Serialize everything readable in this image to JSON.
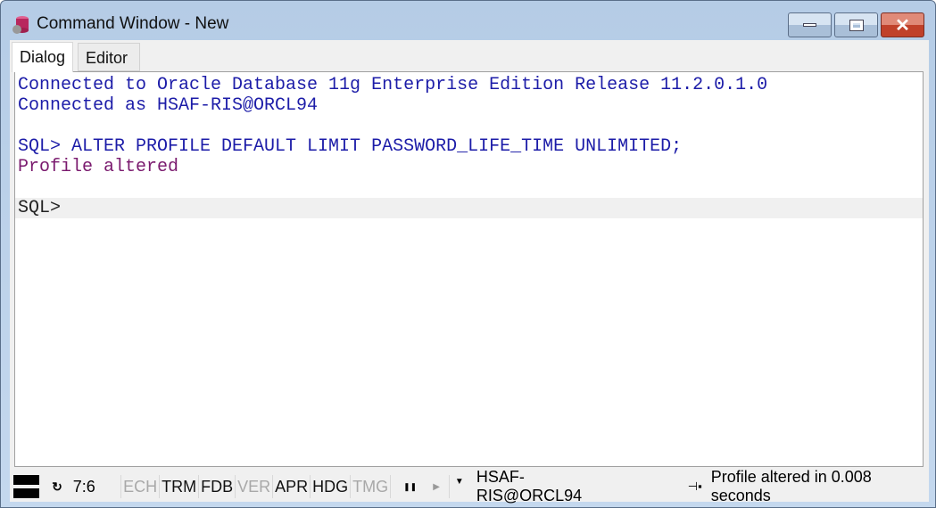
{
  "window": {
    "title": "Command Window - New",
    "controls": {
      "minimize": "minimize",
      "maximize": "maximize",
      "close": "close"
    }
  },
  "tabs": [
    {
      "label": "Dialog",
      "active": true
    },
    {
      "label": "Editor",
      "active": false
    }
  ],
  "output": {
    "lines": [
      {
        "text": "Connected to Oracle Database 11g Enterprise Edition Release 11.2.0.1.0",
        "color": "#1c1ca8"
      },
      {
        "text": "Connected as HSAF-RIS@ORCL94",
        "color": "#1c1ca8"
      },
      {
        "text": "",
        "color": "#1c1ca8"
      },
      {
        "text": "SQL> ALTER PROFILE DEFAULT LIMIT PASSWORD_LIFE_TIME UNLIMITED;",
        "color": "#1c1ca8"
      },
      {
        "text": "Profile altered",
        "color": "#7a1a6e"
      },
      {
        "text": "",
        "color": "#000"
      }
    ],
    "prompt": "SQL>"
  },
  "status": {
    "position": "7:6",
    "indicators": [
      {
        "label": "ECH",
        "enabled": false
      },
      {
        "label": "TRM",
        "enabled": true
      },
      {
        "label": "FDB",
        "enabled": true
      },
      {
        "label": "VER",
        "enabled": false
      },
      {
        "label": "APR",
        "enabled": true
      },
      {
        "label": "HDG",
        "enabled": true
      },
      {
        "label": "TMG",
        "enabled": false
      }
    ],
    "connection": "HSAF-RIS@ORCL94",
    "message": "Profile altered in 0.008 seconds"
  }
}
